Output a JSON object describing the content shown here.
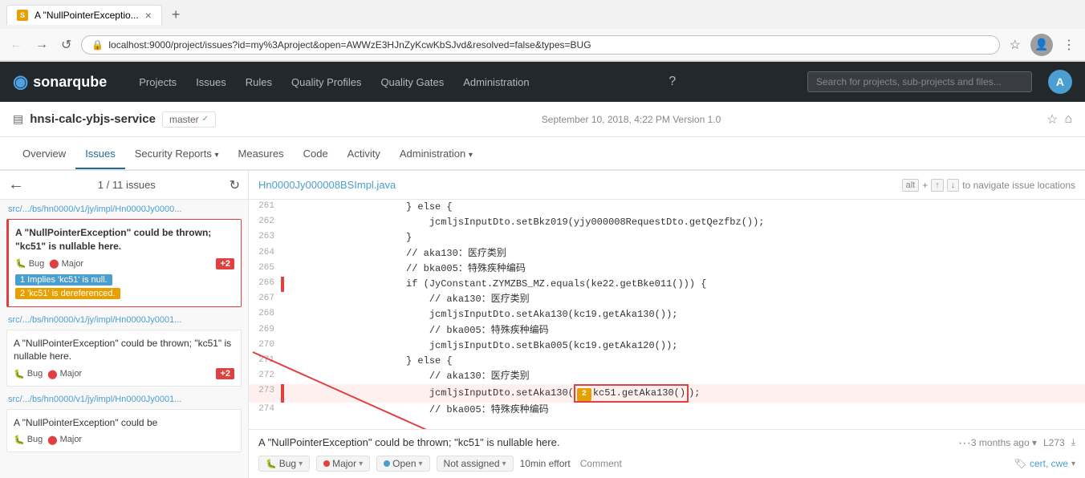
{
  "browser": {
    "tab_title": "A \"NullPointerExceptio...",
    "url": "localhost:9000/project/issues?id=my%3Aproject&open=AWWzE3HJnZyKcwKbSJvd&resolved=false&types=BUG",
    "new_tab_label": "+"
  },
  "sq_header": {
    "logo": "sonarqube",
    "nav_items": [
      {
        "label": "Projects",
        "id": "projects"
      },
      {
        "label": "Issues",
        "id": "issues"
      },
      {
        "label": "Rules",
        "id": "rules"
      },
      {
        "label": "Quality Profiles",
        "id": "quality-profiles"
      },
      {
        "label": "Quality Gates",
        "id": "quality-gates"
      },
      {
        "label": "Administration",
        "id": "administration"
      }
    ],
    "search_placeholder": "Search for projects, sub-projects and files...",
    "avatar_letter": "A"
  },
  "project": {
    "name": "hnsi-calc-ybjs-service",
    "branch": "master",
    "meta": "September 10, 2018, 4:22 PM  Version 1.0",
    "nav_items": [
      {
        "label": "Overview",
        "id": "overview",
        "active": false
      },
      {
        "label": "Issues",
        "id": "issues",
        "active": true
      },
      {
        "label": "Security Reports",
        "id": "security-reports",
        "active": false,
        "has_dropdown": true
      },
      {
        "label": "Measures",
        "id": "measures",
        "active": false
      },
      {
        "label": "Code",
        "id": "code",
        "active": false
      },
      {
        "label": "Activity",
        "id": "activity",
        "active": false
      },
      {
        "label": "Administration",
        "id": "administration",
        "active": false,
        "has_dropdown": true
      }
    ]
  },
  "issues_panel": {
    "count_text": "1 / 11 issues",
    "issues": [
      {
        "path": "src/.../bs/hn0000/v1/jy/impl/Hn0000Jy0000...",
        "title": "A \"NullPointerException\" could be thrown; \"kc51\" is nullable here.",
        "type": "Bug",
        "severity": "Major",
        "extra": "+2",
        "active": true,
        "locations": [
          {
            "num": 1,
            "text": "Implies 'kc51' is null."
          },
          {
            "num": 2,
            "text": "'kc51' is dereferenced."
          }
        ]
      },
      {
        "path": "src/.../bs/hn0000/v1/jy/impl/Hn0000Jy0001...",
        "title": "A \"NullPointerException\" could be thrown; \"kc51\" is nullable here.",
        "type": "Bug",
        "severity": "Major",
        "extra": "+2",
        "active": false,
        "locations": []
      },
      {
        "path": "src/.../bs/hn0000/v1/jy/impl/Hn0000Jy0001...",
        "title": "A \"NullPointerException\" could be",
        "type": "Bug",
        "severity": "Major",
        "extra": "",
        "active": false,
        "locations": []
      }
    ]
  },
  "code_view": {
    "file_name": "Hn0000Jy000008BSImpl.java",
    "navigate_hint": "to navigate issue locations",
    "alt_key": "alt",
    "plus_key": "+",
    "up_key": "↑",
    "down_key": "↓",
    "lines": [
      {
        "num": "261",
        "active": false,
        "content": "                    } else {"
      },
      {
        "num": "262",
        "active": false,
        "content": "                        jcmljsInputDto.setBkz019(yjy000008RequestDto.getQezfbz());"
      },
      {
        "num": "263",
        "active": false,
        "content": "                    }"
      },
      {
        "num": "264",
        "active": false,
        "content": "                    // aka130：医疗类别"
      },
      {
        "num": "265",
        "active": false,
        "content": "                    // bka005：特殊疾种编码"
      },
      {
        "num": "266",
        "active": true,
        "content": "                    if (JyConstant.ZYMZBS_MZ.equals(ke22.getBke011())) {"
      },
      {
        "num": "267",
        "active": false,
        "content": "                        // aka130：医疗类别"
      },
      {
        "num": "268",
        "active": false,
        "content": "                        jcmljsInputDto.setAka130(kc19.getAka130());"
      },
      {
        "num": "269",
        "active": false,
        "content": "                        // bka005：特殊疾种编码"
      },
      {
        "num": "270",
        "active": false,
        "content": "                        jcmljsInputDto.setBka005(kc19.getAka120());"
      },
      {
        "num": "271",
        "active": false,
        "content": "                    } else {"
      },
      {
        "num": "272",
        "active": false,
        "content": "                        // aka130：医疗类别"
      },
      {
        "num": "273",
        "active": true,
        "content": "                        jcmljsInputDto.setAka130(kc51.getAka130());"
      },
      {
        "num": "274",
        "active": false,
        "content": "                        // bka005：特殊疾种编码"
      }
    ]
  },
  "issue_tooltip": {
    "title": "A \"NullPointerException\" could be thrown; \"kc51\" is nullable here.",
    "age": "3 months ago",
    "line": "L273",
    "type_label": "Bug",
    "severity_label": "Major",
    "status_label": "Open",
    "assignee_label": "Not assigned",
    "effort_label": "10min effort",
    "comment_label": "Comment",
    "tags_label": "cert, cwe"
  }
}
